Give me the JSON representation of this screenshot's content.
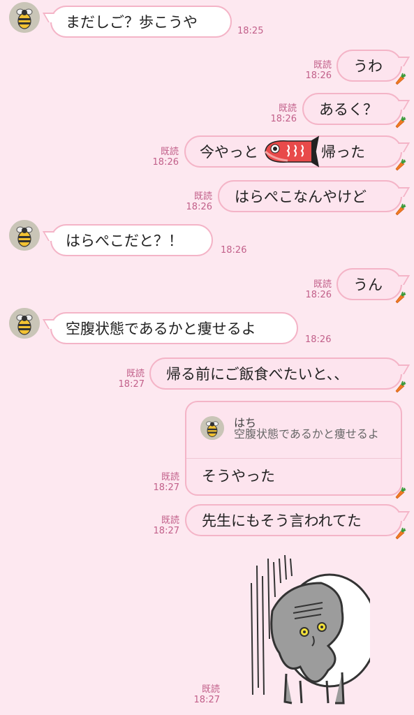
{
  "messages": [
    {
      "text": "まだしご？歩こうや",
      "time": "18:25"
    },
    {
      "text": "うわ",
      "read": "既読",
      "time": "18:26"
    },
    {
      "text": "あるく？",
      "read": "既読",
      "time": "18:26"
    },
    {
      "text_before": "今やっと",
      "text_after": "帰った",
      "read": "既読",
      "time": "18:26"
    },
    {
      "text": "はらぺこなんやけど",
      "read": "既読",
      "time": "18:26"
    },
    {
      "text": "はらぺこだと？！",
      "time": "18:26"
    },
    {
      "text": "うん",
      "read": "既読",
      "time": "18:26"
    },
    {
      "text": "空腹状態であるかと痩せるよ",
      "time": "18:26"
    },
    {
      "text": "帰る前にご飯食べたいと、、",
      "read": "既読",
      "time": "18:27"
    },
    {
      "reply_name": "はち",
      "reply_quote": "空腹状態であるかと痩せるよ",
      "text": "そうやった",
      "read": "既読",
      "time": "18:27"
    },
    {
      "text": "先生にもそう言われてた",
      "read": "既読",
      "time": "18:27"
    },
    {
      "read": "既読",
      "time": "18:27"
    }
  ],
  "icons": {
    "avatar": "bee-icon",
    "reaction": "carrot-icon",
    "sticker": "depressed-character-sticker",
    "inline": "carp-streamer-emoji"
  },
  "colors": {
    "background": "#fde8f0",
    "bubble_border": "#f4b4c7",
    "meta": "#c2608a"
  }
}
